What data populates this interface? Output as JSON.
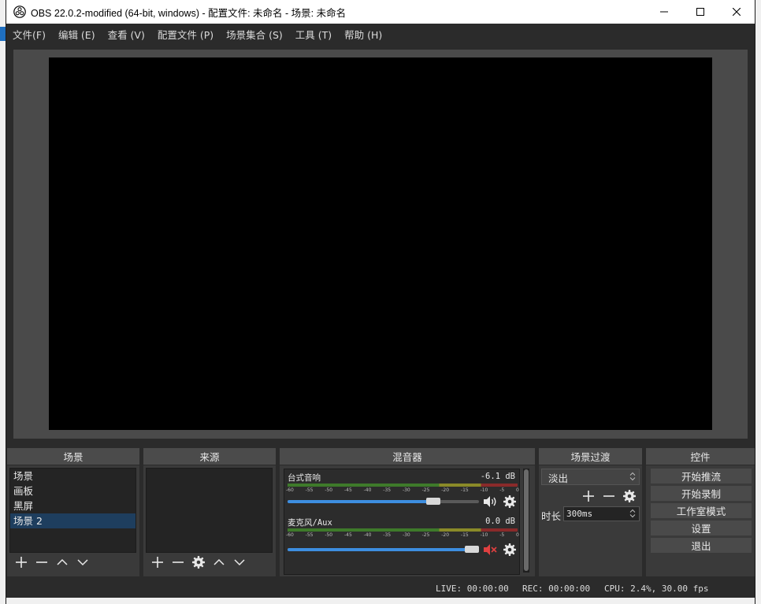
{
  "window": {
    "title": "OBS 22.0.2-modified (64-bit, windows) - 配置文件: 未命名 - 场景: 未命名"
  },
  "menu": [
    "文件(F)",
    "编辑 (E)",
    "查看 (V)",
    "配置文件 (P)",
    "场景集合 (S)",
    "工具 (T)",
    "帮助 (H)"
  ],
  "docks": {
    "scenes": {
      "title": "场景",
      "items": [
        "场景",
        "画板",
        "黑屏",
        "场景 2"
      ],
      "selected_index": 3
    },
    "sources": {
      "title": "来源"
    },
    "mixer": {
      "title": "混音器",
      "scale": [
        "-60",
        "-55",
        "-50",
        "-45",
        "-40",
        "-35",
        "-30",
        "-25",
        "-20",
        "-15",
        "-10",
        "-5",
        "0"
      ],
      "channels": [
        {
          "name": "台式音响",
          "db": "-6.1 dB",
          "volume": 0.78,
          "muted": false
        },
        {
          "name": "麦克风/Aux",
          "db": "0.0 dB",
          "volume": 1.0,
          "muted": true
        }
      ]
    },
    "transitions": {
      "title": "场景过渡",
      "selected": "淡出",
      "duration_label": "时长",
      "duration_value": "300ms"
    },
    "controls": {
      "title": "控件",
      "buttons": [
        "开始推流",
        "开始录制",
        "工作室模式",
        "设置",
        "退出"
      ]
    }
  },
  "status": {
    "live": "LIVE: 00:00:00",
    "rec": "REC: 00:00:00",
    "cpu": "CPU: 2.4%, 30.00 fps"
  },
  "icons": {
    "app": "obs-logo-icon",
    "add": "plus-icon",
    "remove": "minus-icon",
    "up": "chevron-up-icon",
    "down": "chevron-down-icon",
    "settings": "gear-icon",
    "volume": "speaker-icon",
    "muted": "speaker-muted-icon"
  },
  "colors": {
    "accent": "#3d8ee0",
    "selected_row": "#1e3e5e",
    "mute_red": "#e04040"
  }
}
